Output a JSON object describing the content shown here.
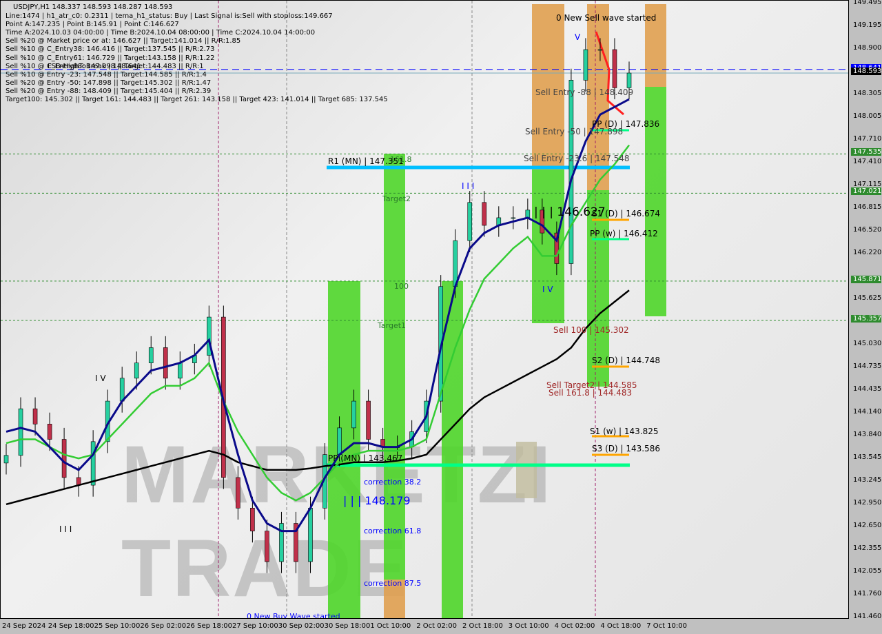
{
  "header": {
    "title": "USDJPY,H1  148.337 148.593 148.287 148.593",
    "lines": [
      "Line:1474 | h1_atr_c0: 0.2311 | tema_h1_status: Buy | Last Signal is:Sell with stoploss:149.667",
      "Point A:147.235 | Point B:145.91 | Point C:146.627",
      "Time A:2024.10.03 04:00:00 | Time B:2024.10.04 08:00:00 | Time C:2024.10.04 14:00:00",
      "Sell %20 @ Market price or at: 146.627 || Target:141.014 || R/R:1.85",
      "Sell %10 @ C_Entry38: 146.416 || Target:137.545 || R/R:2.73",
      "Sell %10 @ C_Entry61: 146.729 || Target:143.158 || R/R:1.22",
      "Sell %10 @ C_Entry88: 147.098 || Target:144.483 || R/R:1",
      "Sell %10 @ Entry -23: 147.548 || Target:144.585 || R/R:1.4",
      "Sell %20 @ Entry -50: 147.898 || Target:145.302 || R/R:1.47",
      "Sell %20 @ Entry -88: 148.409 || Target:145.404 || R/R:2.39",
      "Target100: 145.302 || Target 161: 144.483 || Target 261: 143.158 || Target 423: 141.014 || Target 685: 137.545"
    ],
    "overlap_text": "FSB-HighToBreak | 148.641"
  },
  "watermark": "MARKETZI TRADE",
  "colors": {
    "bull": "#26d0a0",
    "bear": "#c0304a",
    "fast_ma": "#0a0a8a",
    "mid_ma": "#33cc33",
    "slow_ma": "#000000",
    "zone_green": "#4fd62a",
    "zone_orange": "#e0a050",
    "r1": "#00bfff",
    "pp_mn": "#00ff88",
    "fsb": "#0000ff"
  },
  "annotations": {
    "new_sell": "0 New Sell wave started",
    "new_buy": "0 New Buy Wave started",
    "sell_entry_88": "Sell Entry -88 | 148.409",
    "sell_entry_50": "Sell Entry -50 | 147.898",
    "sell_entry_23": "Sell Entry -23.6 | 147.548",
    "r1_mn": "R1 (MN) | 147.351",
    "f1618": "161.8",
    "target2": "Target2",
    "f100": "100",
    "target1": "Target1",
    "pp_d": "PP (D) | 147.836",
    "s1_d": "S1 (D) | 146.674",
    "pp_w": "PP (w) | 146.412",
    "point_c": "| | | 146.627",
    "wave_iv": "I V",
    "wave_v": "V",
    "wave_iii": "I I I",
    "wave_i": "I I",
    "wave_iv2": "I V",
    "sell100": "Sell 100 | 145.302",
    "s2_d": "S2 (D) | 144.748",
    "sell_target2": "Sell Target2 | 144.585",
    "sell1618": "Sell 161.8 | 144.483",
    "s1_w": "S1 (w) | 143.825",
    "s3_d": "S3 (D) | 143.586",
    "pp_mn": "PP (MN) | 143.467",
    "corr382": "correction 38.2",
    "pt_148": "| | | 148.179",
    "corr618": "correction 61.8",
    "corr875": "correction 87.5",
    "wave_iii_low": "I I I"
  },
  "chart_data": {
    "type": "candlestick",
    "symbol": "USDJPY",
    "timeframe": "H1",
    "ylim": [
      141.46,
      149.495
    ],
    "y_ticks": [
      149.495,
      149.195,
      148.9,
      148.305,
      148.005,
      147.71,
      147.41,
      147.115,
      146.815,
      146.52,
      146.22,
      145.625,
      145.03,
      144.735,
      144.435,
      144.14,
      143.84,
      143.545,
      143.245,
      142.95,
      142.65,
      142.355,
      142.055,
      141.76,
      141.46
    ],
    "y_tick_labels": [
      "149.495",
      "149.195",
      "148.900",
      "148.305",
      "148.005",
      "147.710",
      "147.410",
      "147.115",
      "146.815",
      "146.520",
      "146.220",
      "145.625",
      "145.030",
      "144.735",
      "144.435",
      "144.140",
      "143.840",
      "143.545",
      "143.245",
      "142.950",
      "142.650",
      "142.355",
      "142.055",
      "141.760",
      "141.460"
    ],
    "highlight_prices": [
      {
        "label": "148.641",
        "value": 148.641,
        "color": "#0000ff"
      },
      {
        "label": "148.593",
        "value": 148.593,
        "color": "#000000"
      },
      {
        "label": "147.535",
        "value": 147.535,
        "color": "#2e8b2e"
      },
      {
        "label": "147.021",
        "value": 147.021,
        "color": "#2e8b2e"
      },
      {
        "label": "145.871",
        "value": 145.871,
        "color": "#2e8b2e"
      },
      {
        "label": "145.357",
        "value": 145.357,
        "color": "#2e8b2e"
      }
    ],
    "x_labels": [
      "24 Sep 2024",
      "24 Sep 18:00",
      "25 Sep 10:00",
      "26 Sep 02:00",
      "26 Sep 18:00",
      "27 Sep 10:00",
      "30 Sep 02:00",
      "30 Sep 18:00",
      "1 Oct 10:00",
      "2 Oct 02:00",
      "2 Oct 18:00",
      "3 Oct 10:00",
      "4 Oct 02:00",
      "4 Oct 18:00",
      "7 Oct 10:00"
    ],
    "close": [
      143.59,
      144.2,
      144.0,
      143.8,
      143.3,
      143.2,
      143.77,
      144.3,
      144.6,
      144.8,
      145.0,
      144.6,
      144.8,
      144.9,
      145.4,
      143.3,
      142.9,
      142.6,
      142.2,
      142.7,
      142.2,
      142.9,
      143.6,
      143.95,
      144.3,
      143.8,
      143.7,
      143.7,
      143.9,
      144.3,
      145.8,
      146.4,
      146.9,
      146.6,
      146.7,
      146.7,
      146.8,
      146.5,
      146.1,
      148.5,
      148.9,
      148.9,
      148.4,
      148.593
    ],
    "fast_ma": [
      143.9,
      143.95,
      143.9,
      143.7,
      143.5,
      143.4,
      143.6,
      144.0,
      144.3,
      144.5,
      144.7,
      144.75,
      144.8,
      144.9,
      145.1,
      144.3,
      143.6,
      143.0,
      142.7,
      142.6,
      142.6,
      142.9,
      143.3,
      143.6,
      143.75,
      143.75,
      143.7,
      143.7,
      143.8,
      144.1,
      145.0,
      145.8,
      146.3,
      146.5,
      146.6,
      146.65,
      146.7,
      146.6,
      146.4,
      147.2,
      147.7,
      148.05,
      148.15,
      148.25
    ],
    "mid_ma": [
      143.75,
      143.8,
      143.8,
      143.7,
      143.6,
      143.55,
      143.6,
      143.8,
      144.0,
      144.2,
      144.4,
      144.5,
      144.5,
      144.6,
      144.8,
      144.3,
      143.9,
      143.6,
      143.3,
      143.1,
      143.0,
      143.1,
      143.3,
      143.5,
      143.6,
      143.65,
      143.65,
      143.65,
      143.7,
      143.8,
      144.4,
      145.0,
      145.5,
      145.9,
      146.1,
      146.3,
      146.45,
      146.2,
      146.2,
      146.6,
      146.9,
      147.2,
      147.4,
      147.65
    ],
    "slow_ma": [
      142.95,
      143.0,
      143.05,
      143.1,
      143.15,
      143.2,
      143.25,
      143.3,
      143.35,
      143.4,
      143.45,
      143.5,
      143.55,
      143.6,
      143.65,
      143.6,
      143.5,
      143.45,
      143.4,
      143.4,
      143.4,
      143.42,
      143.45,
      143.47,
      143.5,
      143.5,
      143.5,
      143.52,
      143.55,
      143.6,
      143.8,
      144.0,
      144.2,
      144.35,
      144.45,
      144.55,
      144.65,
      144.75,
      144.85,
      145.0,
      145.25,
      145.45,
      145.6,
      145.75
    ],
    "levels": [
      {
        "name": "FSB-HighToBreak",
        "value": 148.641,
        "style": "dashed",
        "color": "#0000ff"
      },
      {
        "name": "147.535",
        "value": 147.535,
        "style": "dotted",
        "color": "#2e8b2e"
      },
      {
        "name": "147.021",
        "value": 147.021,
        "style": "dotted",
        "color": "#2e8b2e"
      },
      {
        "name": "145.871",
        "value": 145.871,
        "style": "dotted",
        "color": "#2e8b2e"
      },
      {
        "name": "145.357",
        "value": 145.357,
        "style": "dotted",
        "color": "#2e8b2e"
      }
    ]
  }
}
